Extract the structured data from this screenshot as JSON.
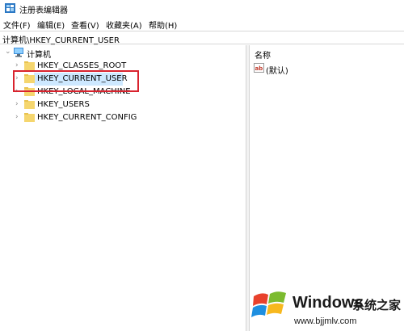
{
  "window": {
    "title": "注册表编辑器"
  },
  "menu": {
    "items": [
      {
        "label": "文件(F)"
      },
      {
        "label": "编辑(E)"
      },
      {
        "label": "查看(V)"
      },
      {
        "label": "收藏夹(A)"
      },
      {
        "label": "帮助(H)"
      }
    ]
  },
  "address": {
    "path": "计算机\\HKEY_CURRENT_USER"
  },
  "tree": {
    "root": {
      "label": "计算机",
      "icon": "computer-icon",
      "expanded": true
    },
    "keys": [
      {
        "label": "HKEY_CLASSES_ROOT",
        "icon": "folder-icon",
        "selected": false
      },
      {
        "label": "HKEY_CURRENT_USER",
        "icon": "folder-icon",
        "selected": true
      },
      {
        "label": "HKEY_LOCAL_MACHINE",
        "icon": "folder-icon",
        "selected": false
      },
      {
        "label": "HKEY_USERS",
        "icon": "folder-icon",
        "selected": false
      },
      {
        "label": "HKEY_CURRENT_CONFIG",
        "icon": "folder-icon",
        "selected": false
      }
    ]
  },
  "list": {
    "column_name": "名称",
    "values": [
      {
        "name": "(默认)",
        "icon": "string-value-icon"
      }
    ]
  },
  "watermark": {
    "title": "Windows",
    "subtitle": "系统之家",
    "url": "www.bjjmlv.com"
  },
  "colors": {
    "selection": "#cde8ff",
    "highlight_box": "#d9232e",
    "folder": "#f5d66e",
    "app_accent": "#2b78c4"
  }
}
